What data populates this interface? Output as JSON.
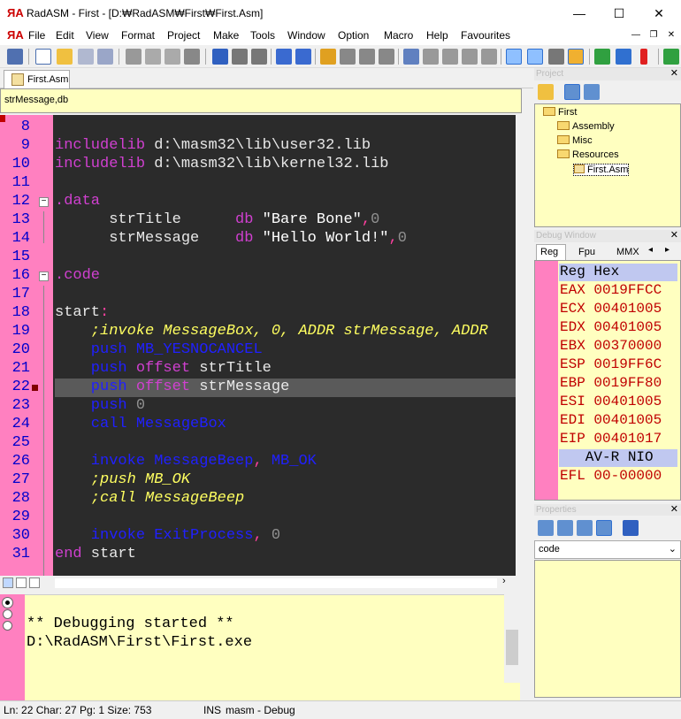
{
  "window": {
    "title": "RadASM - First - [D:₩RadASM₩First₩First.Asm]",
    "minimize": "—",
    "maximize": "☐",
    "close": "✕"
  },
  "menu": {
    "items": [
      "File",
      "Edit",
      "View",
      "Format",
      "Project",
      "Make",
      "Tools",
      "Window",
      "Option",
      "Macro",
      "Help",
      "Favourites"
    ],
    "mdi_min": "—",
    "mdi_restore": "❐",
    "mdi_close": "✕"
  },
  "tabs": {
    "active": "First.Asm"
  },
  "procbar": {
    "value": "strMessage,db"
  },
  "editor": {
    "lines": [
      {
        "n": "8",
        "parts": []
      },
      {
        "n": "9",
        "parts": [
          {
            "t": "includelib",
            "c": "kw-purple"
          },
          {
            "t": " d:\\masm32\\lib\\user32.lib",
            "c": "kw-white"
          }
        ]
      },
      {
        "n": "10",
        "parts": [
          {
            "t": "includelib",
            "c": "kw-purple"
          },
          {
            "t": " d:\\masm32\\lib\\kernel32.lib",
            "c": "kw-white"
          }
        ]
      },
      {
        "n": "11",
        "parts": []
      },
      {
        "n": "12",
        "parts": [
          {
            "t": ".data",
            "c": "kw-purple"
          }
        ]
      },
      {
        "n": "13",
        "parts": [
          {
            "t": "      strTitle      ",
            "c": "kw-white"
          },
          {
            "t": "db",
            "c": "kw-purple"
          },
          {
            "t": " \"Bare Bone\"",
            "c": "str"
          },
          {
            "t": ",",
            "c": "red"
          },
          {
            "t": "0",
            "c": "num"
          }
        ]
      },
      {
        "n": "14",
        "parts": [
          {
            "t": "      strMessage    ",
            "c": "kw-white"
          },
          {
            "t": "db",
            "c": "kw-purple"
          },
          {
            "t": " \"Hello World!\"",
            "c": "str"
          },
          {
            "t": ",",
            "c": "red"
          },
          {
            "t": "0",
            "c": "num"
          }
        ]
      },
      {
        "n": "15",
        "parts": []
      },
      {
        "n": "16",
        "parts": [
          {
            "t": ".code",
            "c": "kw-purple"
          }
        ]
      },
      {
        "n": "17",
        "parts": []
      },
      {
        "n": "18",
        "parts": [
          {
            "t": "start",
            "c": "kw-white"
          },
          {
            "t": ":",
            "c": "red"
          }
        ]
      },
      {
        "n": "19",
        "parts": [
          {
            "t": "    ;invoke MessageBox, 0, ADDR strMessage, ADDR",
            "c": "cmt"
          }
        ]
      },
      {
        "n": "20",
        "parts": [
          {
            "t": "    push ",
            "c": "kw-blue"
          },
          {
            "t": "MB_YESNOCANCEL",
            "c": "kw-blue"
          }
        ]
      },
      {
        "n": "21",
        "parts": [
          {
            "t": "    push ",
            "c": "kw-blue"
          },
          {
            "t": "offset",
            "c": "kw-purple"
          },
          {
            "t": " strTitle",
            "c": "kw-white"
          }
        ]
      },
      {
        "n": "22",
        "parts": [
          {
            "t": "    push ",
            "c": "kw-blue"
          },
          {
            "t": "offset",
            "c": "kw-purple"
          },
          {
            "t": " strMessage",
            "c": "kw-white"
          }
        ]
      },
      {
        "n": "23",
        "parts": [
          {
            "t": "    push ",
            "c": "kw-blue"
          },
          {
            "t": "0",
            "c": "num"
          }
        ]
      },
      {
        "n": "24",
        "parts": [
          {
            "t": "    call ",
            "c": "kw-blue"
          },
          {
            "t": "MessageBox",
            "c": "kw-blue"
          }
        ]
      },
      {
        "n": "25",
        "parts": []
      },
      {
        "n": "26",
        "parts": [
          {
            "t": "    invoke ",
            "c": "kw-blue"
          },
          {
            "t": "MessageBeep",
            "c": "kw-blue"
          },
          {
            "t": ", ",
            "c": "red"
          },
          {
            "t": "MB_OK",
            "c": "kw-blue"
          }
        ]
      },
      {
        "n": "27",
        "parts": [
          {
            "t": "    ;push MB_OK",
            "c": "cmt"
          }
        ]
      },
      {
        "n": "28",
        "parts": [
          {
            "t": "    ;call MessageBeep",
            "c": "cmt"
          }
        ]
      },
      {
        "n": "29",
        "parts": []
      },
      {
        "n": "30",
        "parts": [
          {
            "t": "    invoke ",
            "c": "kw-blue"
          },
          {
            "t": "ExitProcess",
            "c": "kw-blue"
          },
          {
            "t": ", ",
            "c": "red"
          },
          {
            "t": "0",
            "c": "num"
          }
        ]
      },
      {
        "n": "31",
        "parts": [
          {
            "t": "end",
            "c": "kw-purple"
          },
          {
            "t": " start",
            "c": "kw-white"
          }
        ]
      }
    ],
    "fold_minus": "−"
  },
  "output": {
    "lines": [
      "",
      "** Debugging started **",
      "D:\\RadASM\\First\\First.exe"
    ]
  },
  "status": {
    "position": "Ln: 22 Char: 27 Pg: 1 Size: 753",
    "mode": "INS",
    "build": "masm - Debug"
  },
  "project": {
    "header": "Project",
    "tree": [
      {
        "label": "First",
        "level": 0,
        "kind": "folder"
      },
      {
        "label": "Assembly",
        "level": 1,
        "kind": "folder"
      },
      {
        "label": "Misc",
        "level": 1,
        "kind": "folder"
      },
      {
        "label": "Resources",
        "level": 1,
        "kind": "folder"
      },
      {
        "label": "First.Asm",
        "level": 2,
        "kind": "file"
      }
    ]
  },
  "debug": {
    "header": "Debug Window",
    "tabs": [
      "Reg",
      "Fpu",
      "MMX"
    ],
    "columns": "Reg Hex",
    "registers": [
      "EAX 0019FFCC",
      "ECX 00401005",
      "EDX 00401005",
      "EBX 00370000",
      "ESP 0019FF6C",
      "EBP 0019FF80",
      "ESI 00401005",
      "EDI 00401005",
      "EIP 00401017"
    ],
    "flags_header": "   AV-R NIO",
    "efl": "EFL 00-00000"
  },
  "properties": {
    "header": "Properties",
    "selected": "code"
  },
  "colors": {
    "gutter": "#ff80c0",
    "editor_bg": "#2b2b2b",
    "panel_bg": "#ffffc0"
  }
}
